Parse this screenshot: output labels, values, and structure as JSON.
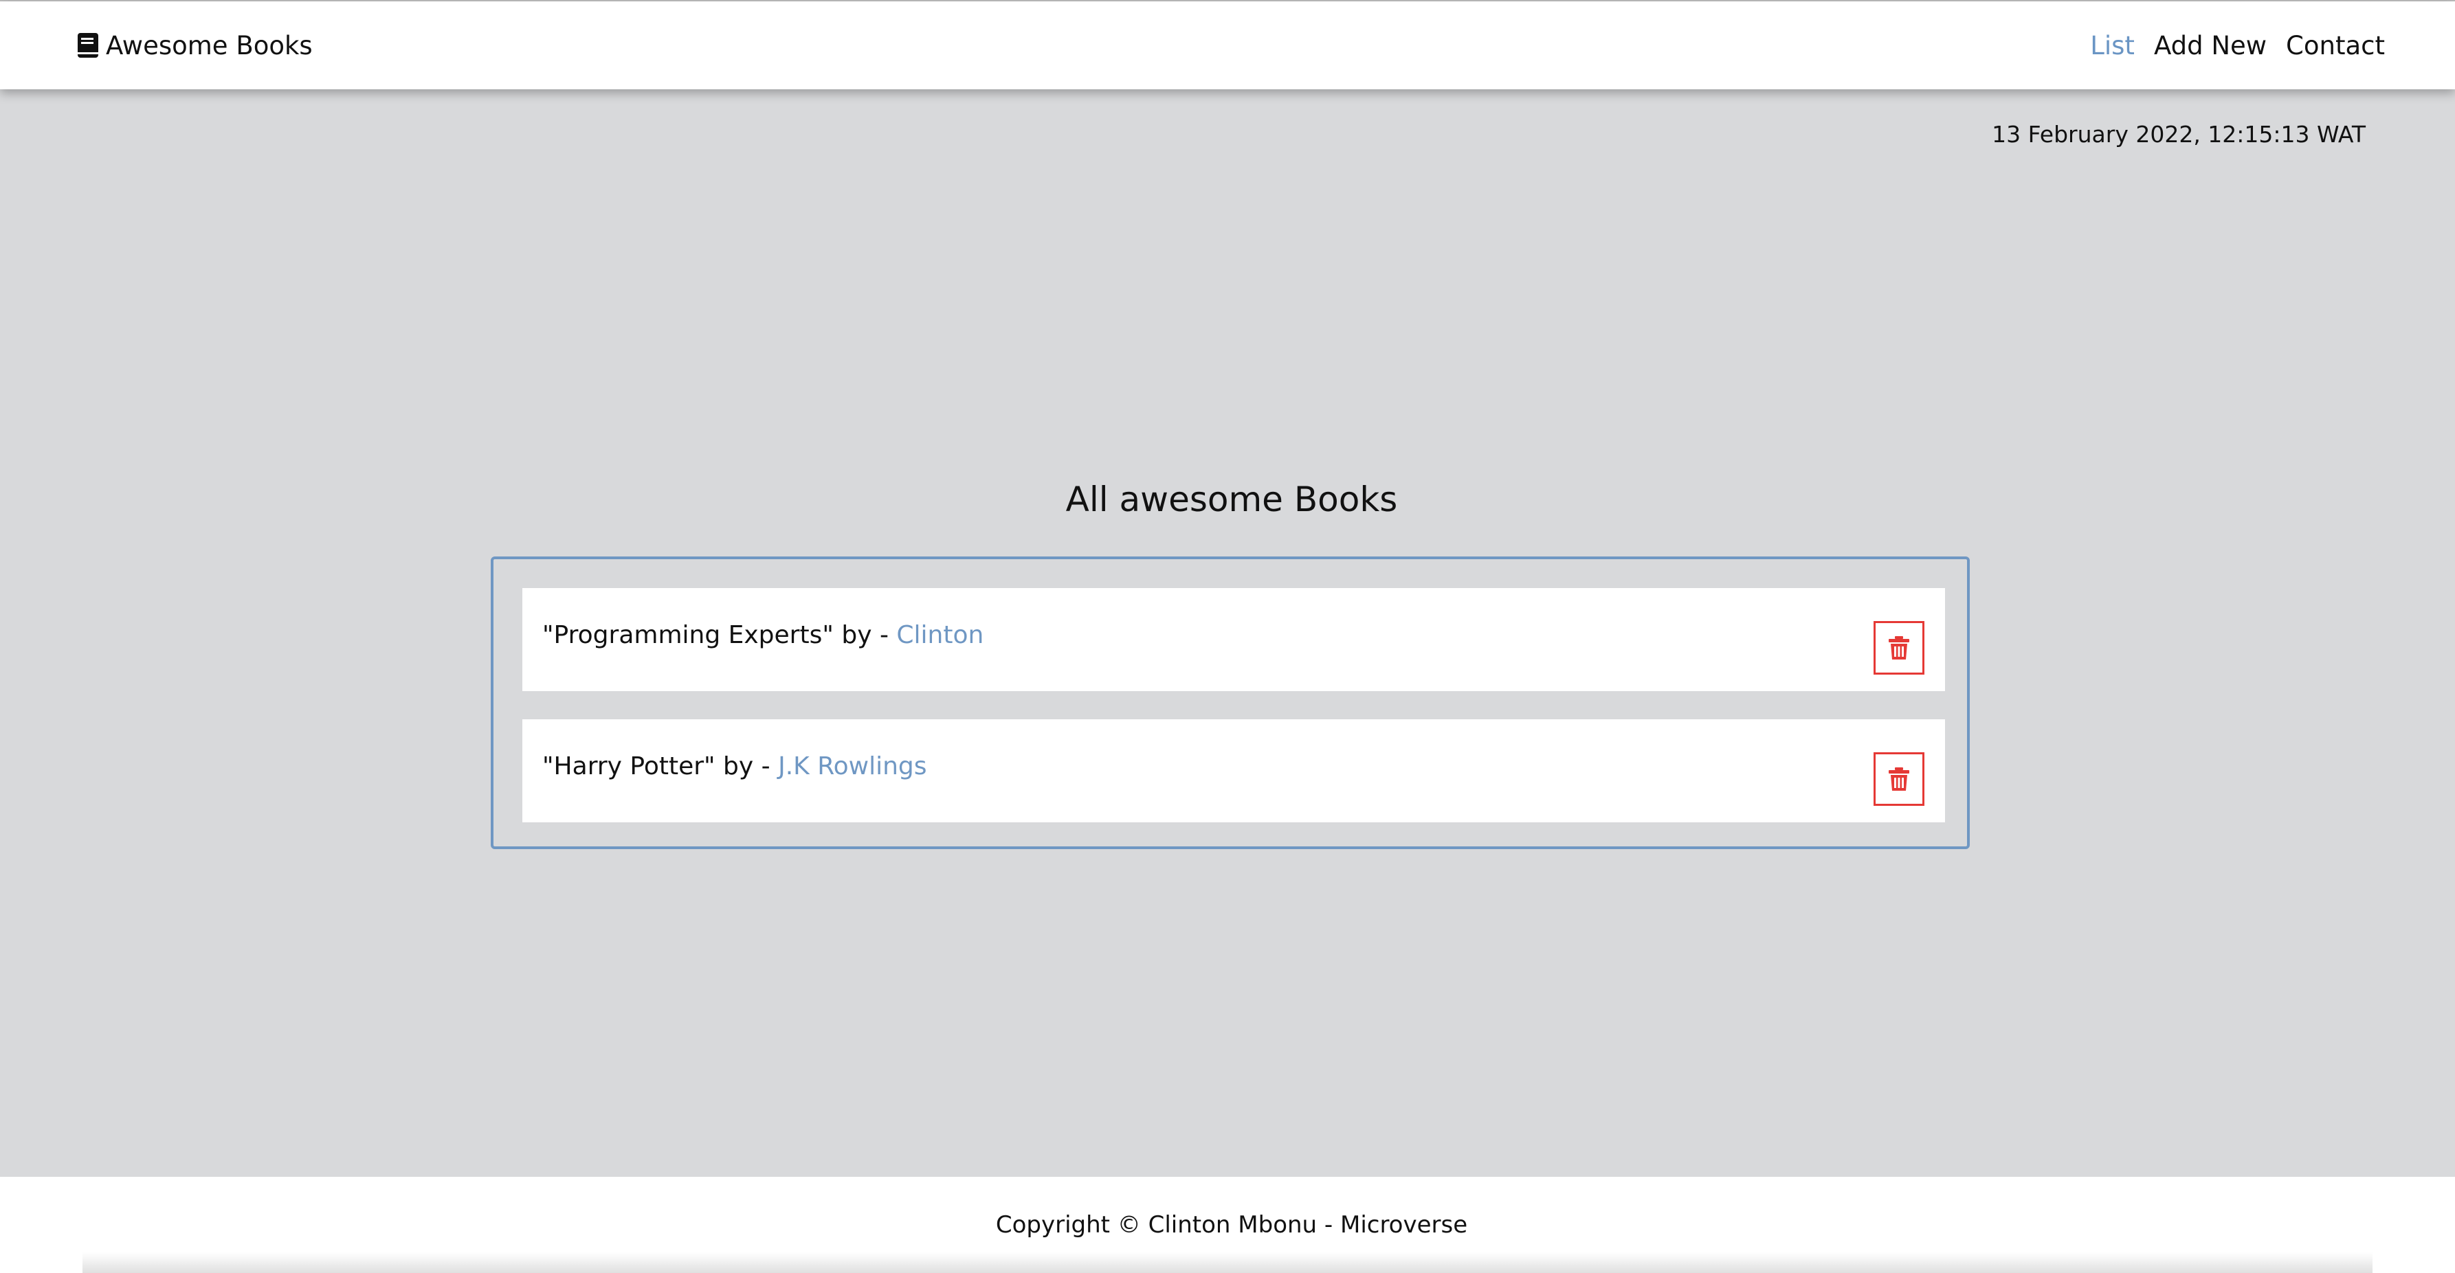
{
  "header": {
    "brand": "Awesome Books",
    "brand_icon": "book-icon",
    "nav": [
      {
        "label": "List",
        "active": true
      },
      {
        "label": "Add New",
        "active": false
      },
      {
        "label": "Contact",
        "active": false
      }
    ]
  },
  "datetime": "13 February 2022, 12:15:13 WAT",
  "main": {
    "title": "All awesome Books",
    "books": [
      {
        "title": "\"Programming Experts\"",
        "separator": " by - ",
        "author": "Clinton",
        "delete_icon": "trash-icon"
      },
      {
        "title": "\"Harry Potter\"",
        "separator": " by - ",
        "author": "J.K Rowlings",
        "delete_icon": "trash-icon"
      }
    ]
  },
  "footer": {
    "text": "Copyright © Clinton Mbonu - Microverse"
  },
  "colors": {
    "accent": "#6f97c3",
    "danger": "#e53935",
    "background": "#d8d9db"
  }
}
